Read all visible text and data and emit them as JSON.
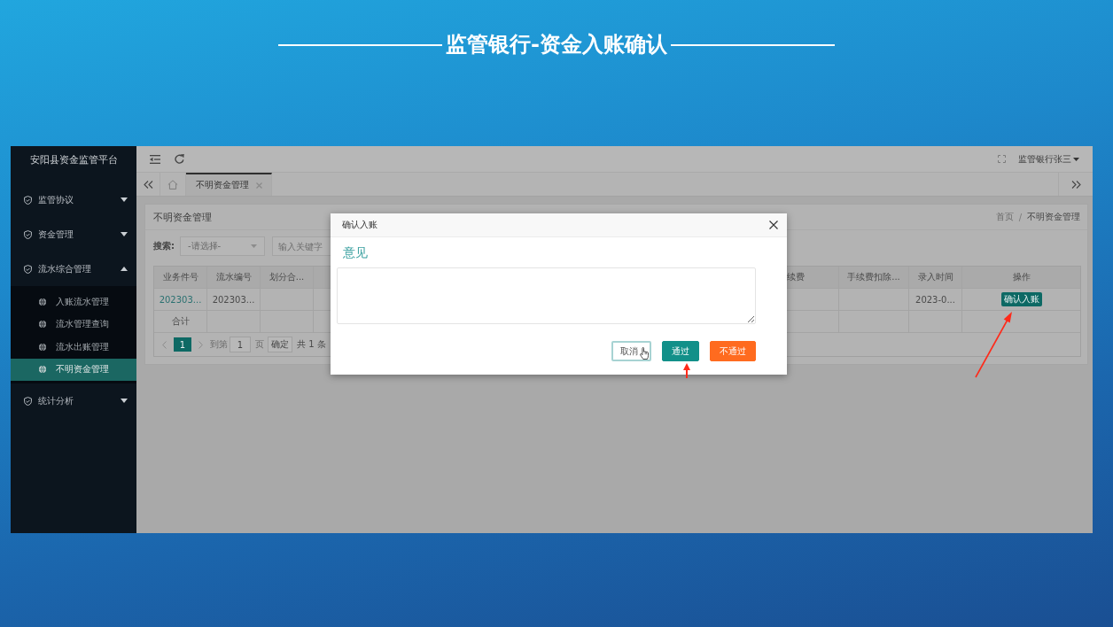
{
  "slide": {
    "title": "监管银行-资金入账确认"
  },
  "sidebar": {
    "title": "安阳县资金监管平台",
    "items": [
      {
        "label": "监管协议",
        "expanded": false
      },
      {
        "label": "资金管理",
        "expanded": false
      },
      {
        "label": "流水综合管理",
        "expanded": true,
        "children": [
          {
            "label": "入账流水管理",
            "selected": false
          },
          {
            "label": "流水管理查询",
            "selected": false
          },
          {
            "label": "流水出账管理",
            "selected": false
          },
          {
            "label": "不明资金管理",
            "selected": true
          }
        ]
      },
      {
        "label": "统计分析",
        "expanded": false
      }
    ]
  },
  "header": {
    "user": "监管银行张三"
  },
  "tabs": [
    {
      "label": "不明资金管理",
      "selected": true
    }
  ],
  "page": {
    "title": "不明资金管理",
    "breadcrumb": {
      "items": [
        "首页",
        "不明资金管理"
      ],
      "separator": "/"
    },
    "search": {
      "label": "搜索:",
      "select_value": "-请选择-",
      "keyword_placeholder": "输入关键字"
    },
    "table": {
      "columns": [
        "业务件号",
        "流水编号",
        "划分合...",
        "续费",
        "手续费扣除...",
        "录入时间",
        "操作"
      ],
      "rows": [
        {
          "cells": [
            {
              "text": "202303...",
              "kind": "link"
            },
            {
              "text": "202303...",
              "kind": "text"
            },
            null,
            null,
            null,
            {
              "text": "2023-0...",
              "kind": "text"
            },
            {
              "text": "确认入账",
              "kind": "button"
            }
          ]
        }
      ],
      "summary": "合计"
    },
    "pagination": {
      "pages": [
        {
          "label": "1",
          "selected": true
        }
      ],
      "goto_label": "到第",
      "goto_value": "1",
      "page_unit": "页",
      "confirm": "确定",
      "total": "共 1 条"
    }
  },
  "dialog": {
    "title": "确认入账",
    "field_label": "意见",
    "buttons": [
      {
        "label": "取消",
        "kind": "default",
        "hovered": true
      },
      {
        "label": "通过",
        "kind": "primary",
        "hovered": false
      },
      {
        "label": "不通过",
        "kind": "danger",
        "hovered": false
      }
    ]
  }
}
